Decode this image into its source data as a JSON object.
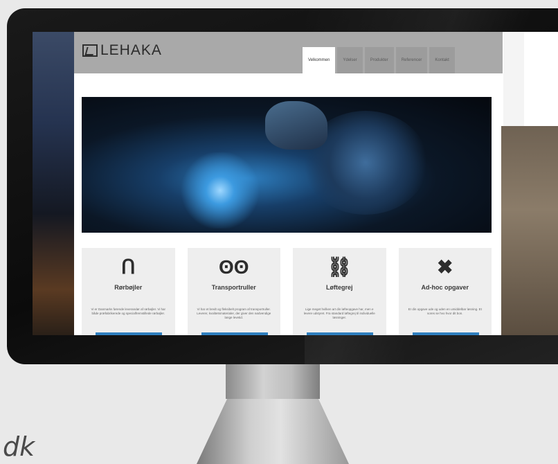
{
  "site": {
    "logo": "LEHAKA",
    "logo_sub": "",
    "header_info": ""
  },
  "nav": {
    "tabs": [
      "Velkommen",
      "Ydelser",
      "Produkter",
      "Referencer",
      "Kontakt"
    ],
    "active": 0
  },
  "features": [
    {
      "icon": "ᑎ",
      "title": "Rørbøjler",
      "text": "Vi er Danmarks førende leverandør af rørbøjler. Vi har både præfabrikerede og specialfremstillede rørbøjler."
    },
    {
      "icon": "ʘʘ",
      "title": "Transportruller",
      "text": "Vi har et bredt og fleksibelt program af transportruller. Leverer, kvalitetsmaterialer, der giver den nødvendige lange levetid."
    },
    {
      "icon": "⛓",
      "title": "Løftegrej",
      "text": "Lige meget hvilken art din løfteopgave har, men e levere udstyret. Fra standard løftegrej til individuelle løsninger."
    },
    {
      "icon": "✖",
      "title": "Ad-hoc opgaver",
      "text": "Er din opgave ude og uden en umiddelbar løsning. Et sores se hvo hvor dit bon."
    }
  ],
  "footer_text": "dk",
  "colors": {
    "accent": "#2f7fbf",
    "header": "#a9a9a9"
  }
}
